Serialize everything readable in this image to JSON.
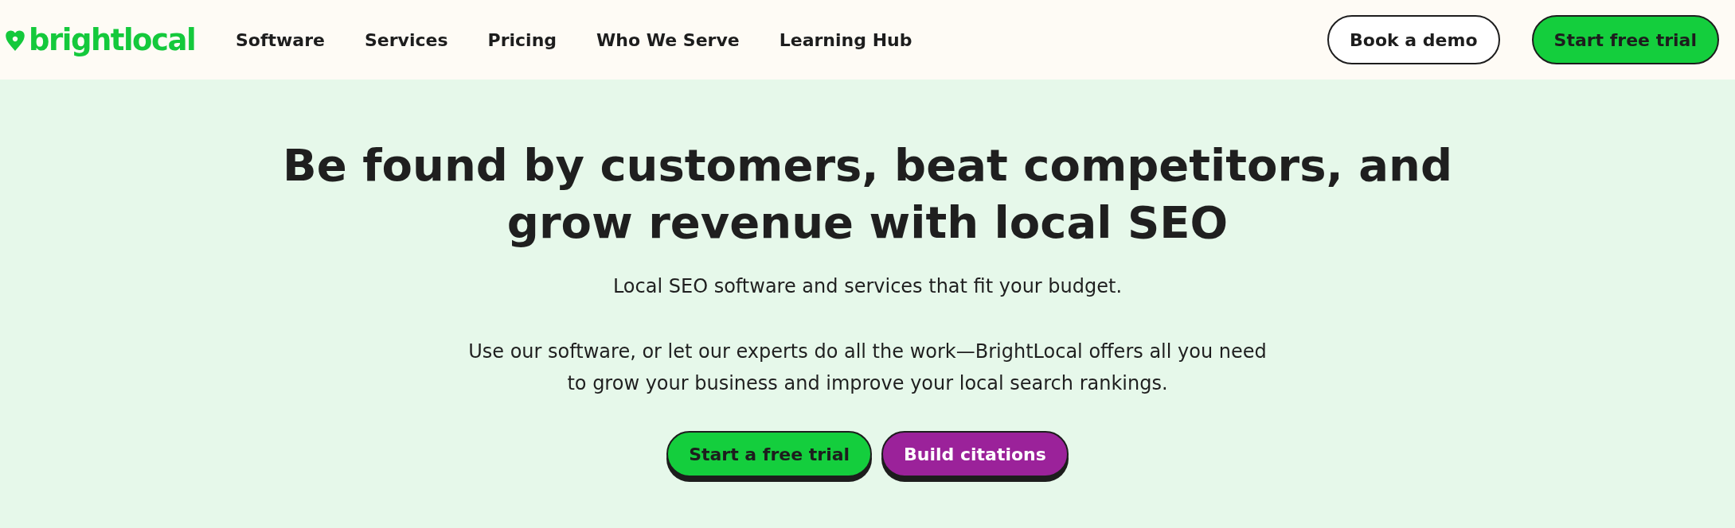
{
  "header": {
    "logo": "brightlocal",
    "nav": [
      "Software",
      "Services",
      "Pricing",
      "Who We Serve",
      "Learning Hub"
    ],
    "actions": [
      {
        "label": "Book a demo",
        "kind": "outline"
      },
      {
        "label": "Start free trial",
        "kind": "green"
      }
    ]
  },
  "hero": {
    "title": "Be found by customers, beat competitors, and grow revenue with local SEO",
    "subtitle": "Local SEO software and services that fit your budget.",
    "body": "Use our software, or let our experts do all the work—BrightLocal offers all you need to grow your business and improve your local search rankings.",
    "buttons": [
      {
        "label": "Start a free trial",
        "kind": "green"
      },
      {
        "label": "Build citations",
        "kind": "purple"
      }
    ]
  }
}
